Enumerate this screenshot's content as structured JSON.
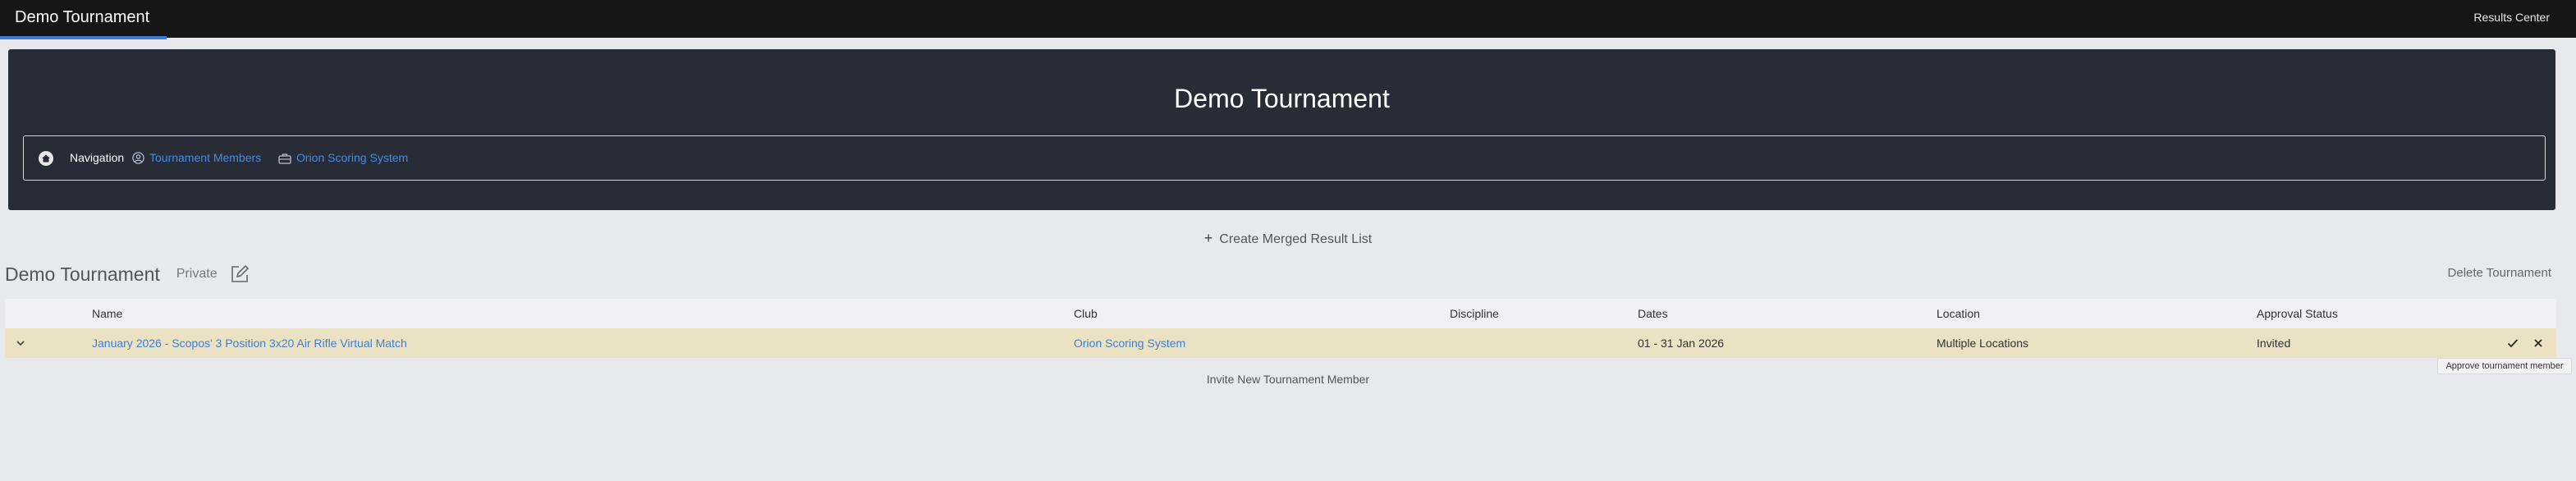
{
  "topbar": {
    "brand": "Demo Tournament",
    "right_link": "Results Center"
  },
  "hero": {
    "title": "Demo Tournament",
    "nav": {
      "label": "Navigation",
      "links": [
        {
          "label": "Tournament Members",
          "icon": "user-circle-icon"
        },
        {
          "label": "Orion Scoring System",
          "icon": "toolbox-icon"
        }
      ]
    }
  },
  "actions": {
    "create_merged": "Create Merged Result List",
    "delete_tournament": "Delete Tournament",
    "invite_member": "Invite New Tournament Member"
  },
  "tournament": {
    "name": "Demo Tournament",
    "visibility": "Private"
  },
  "table": {
    "columns": [
      "Name",
      "Club",
      "Discipline",
      "Dates",
      "Location",
      "Approval Status"
    ],
    "rows": [
      {
        "name": "January 2026 - Scopos' 3 Position 3x20 Air Rifle Virtual Match",
        "club": "Orion Scoring System",
        "discipline": "",
        "dates": "01 - 31 Jan 2026",
        "location": "Multiple Locations",
        "approval_status": "Invited"
      }
    ]
  },
  "tooltip": "Approve tournament member",
  "colors": {
    "topbar": "#161616",
    "hero": "#272c36",
    "link": "#4a8ae0",
    "row_highlight": "#ebe2c3",
    "accent": "#3a7bd5"
  }
}
